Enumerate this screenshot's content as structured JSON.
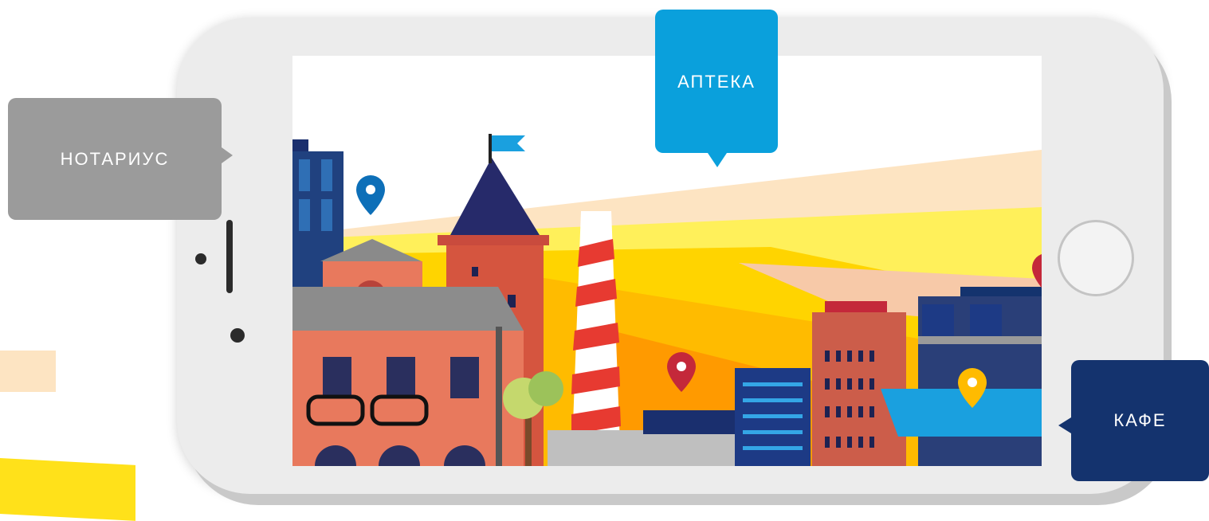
{
  "labels": {
    "notary": "НОТАРИУС",
    "pharmacy": "АПТЕКА",
    "cafe": "КАФЕ"
  },
  "colors": {
    "notary_bubble": "#9b9b9b",
    "pharmacy_bubble": "#0aa0dc",
    "cafe_bubble": "#14336e",
    "phone_body": "#ececec",
    "accent_yellow": "#ffe11a"
  },
  "icons": [
    "map-pin-blue-icon",
    "map-pin-red-icon",
    "map-pin-yellow-icon",
    "flag-icon"
  ]
}
